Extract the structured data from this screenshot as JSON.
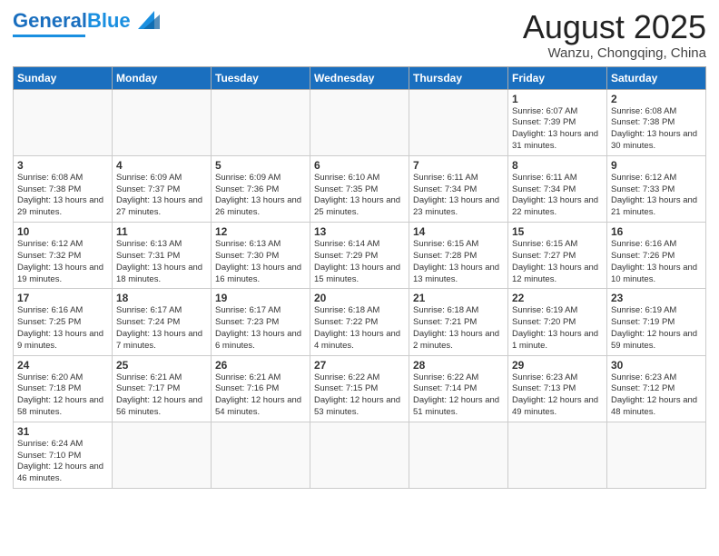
{
  "header": {
    "logo_general": "General",
    "logo_blue": "Blue",
    "month_year": "August 2025",
    "location": "Wanzu, Chongqing, China"
  },
  "weekdays": [
    "Sunday",
    "Monday",
    "Tuesday",
    "Wednesday",
    "Thursday",
    "Friday",
    "Saturday"
  ],
  "weeks": [
    [
      {
        "day": "",
        "info": ""
      },
      {
        "day": "",
        "info": ""
      },
      {
        "day": "",
        "info": ""
      },
      {
        "day": "",
        "info": ""
      },
      {
        "day": "",
        "info": ""
      },
      {
        "day": "1",
        "info": "Sunrise: 6:07 AM\nSunset: 7:39 PM\nDaylight: 13 hours\nand 31 minutes."
      },
      {
        "day": "2",
        "info": "Sunrise: 6:08 AM\nSunset: 7:38 PM\nDaylight: 13 hours\nand 30 minutes."
      }
    ],
    [
      {
        "day": "3",
        "info": "Sunrise: 6:08 AM\nSunset: 7:38 PM\nDaylight: 13 hours\nand 29 minutes."
      },
      {
        "day": "4",
        "info": "Sunrise: 6:09 AM\nSunset: 7:37 PM\nDaylight: 13 hours\nand 27 minutes."
      },
      {
        "day": "5",
        "info": "Sunrise: 6:09 AM\nSunset: 7:36 PM\nDaylight: 13 hours\nand 26 minutes."
      },
      {
        "day": "6",
        "info": "Sunrise: 6:10 AM\nSunset: 7:35 PM\nDaylight: 13 hours\nand 25 minutes."
      },
      {
        "day": "7",
        "info": "Sunrise: 6:11 AM\nSunset: 7:34 PM\nDaylight: 13 hours\nand 23 minutes."
      },
      {
        "day": "8",
        "info": "Sunrise: 6:11 AM\nSunset: 7:34 PM\nDaylight: 13 hours\nand 22 minutes."
      },
      {
        "day": "9",
        "info": "Sunrise: 6:12 AM\nSunset: 7:33 PM\nDaylight: 13 hours\nand 21 minutes."
      }
    ],
    [
      {
        "day": "10",
        "info": "Sunrise: 6:12 AM\nSunset: 7:32 PM\nDaylight: 13 hours\nand 19 minutes."
      },
      {
        "day": "11",
        "info": "Sunrise: 6:13 AM\nSunset: 7:31 PM\nDaylight: 13 hours\nand 18 minutes."
      },
      {
        "day": "12",
        "info": "Sunrise: 6:13 AM\nSunset: 7:30 PM\nDaylight: 13 hours\nand 16 minutes."
      },
      {
        "day": "13",
        "info": "Sunrise: 6:14 AM\nSunset: 7:29 PM\nDaylight: 13 hours\nand 15 minutes."
      },
      {
        "day": "14",
        "info": "Sunrise: 6:15 AM\nSunset: 7:28 PM\nDaylight: 13 hours\nand 13 minutes."
      },
      {
        "day": "15",
        "info": "Sunrise: 6:15 AM\nSunset: 7:27 PM\nDaylight: 13 hours\nand 12 minutes."
      },
      {
        "day": "16",
        "info": "Sunrise: 6:16 AM\nSunset: 7:26 PM\nDaylight: 13 hours\nand 10 minutes."
      }
    ],
    [
      {
        "day": "17",
        "info": "Sunrise: 6:16 AM\nSunset: 7:25 PM\nDaylight: 13 hours\nand 9 minutes."
      },
      {
        "day": "18",
        "info": "Sunrise: 6:17 AM\nSunset: 7:24 PM\nDaylight: 13 hours\nand 7 minutes."
      },
      {
        "day": "19",
        "info": "Sunrise: 6:17 AM\nSunset: 7:23 PM\nDaylight: 13 hours\nand 6 minutes."
      },
      {
        "day": "20",
        "info": "Sunrise: 6:18 AM\nSunset: 7:22 PM\nDaylight: 13 hours\nand 4 minutes."
      },
      {
        "day": "21",
        "info": "Sunrise: 6:18 AM\nSunset: 7:21 PM\nDaylight: 13 hours\nand 2 minutes."
      },
      {
        "day": "22",
        "info": "Sunrise: 6:19 AM\nSunset: 7:20 PM\nDaylight: 13 hours\nand 1 minute."
      },
      {
        "day": "23",
        "info": "Sunrise: 6:19 AM\nSunset: 7:19 PM\nDaylight: 12 hours\nand 59 minutes."
      }
    ],
    [
      {
        "day": "24",
        "info": "Sunrise: 6:20 AM\nSunset: 7:18 PM\nDaylight: 12 hours\nand 58 minutes."
      },
      {
        "day": "25",
        "info": "Sunrise: 6:21 AM\nSunset: 7:17 PM\nDaylight: 12 hours\nand 56 minutes."
      },
      {
        "day": "26",
        "info": "Sunrise: 6:21 AM\nSunset: 7:16 PM\nDaylight: 12 hours\nand 54 minutes."
      },
      {
        "day": "27",
        "info": "Sunrise: 6:22 AM\nSunset: 7:15 PM\nDaylight: 12 hours\nand 53 minutes."
      },
      {
        "day": "28",
        "info": "Sunrise: 6:22 AM\nSunset: 7:14 PM\nDaylight: 12 hours\nand 51 minutes."
      },
      {
        "day": "29",
        "info": "Sunrise: 6:23 AM\nSunset: 7:13 PM\nDaylight: 12 hours\nand 49 minutes."
      },
      {
        "day": "30",
        "info": "Sunrise: 6:23 AM\nSunset: 7:12 PM\nDaylight: 12 hours\nand 48 minutes."
      }
    ],
    [
      {
        "day": "31",
        "info": "Sunrise: 6:24 AM\nSunset: 7:10 PM\nDaylight: 12 hours\nand 46 minutes."
      },
      {
        "day": "",
        "info": ""
      },
      {
        "day": "",
        "info": ""
      },
      {
        "day": "",
        "info": ""
      },
      {
        "day": "",
        "info": ""
      },
      {
        "day": "",
        "info": ""
      },
      {
        "day": "",
        "info": ""
      }
    ]
  ]
}
